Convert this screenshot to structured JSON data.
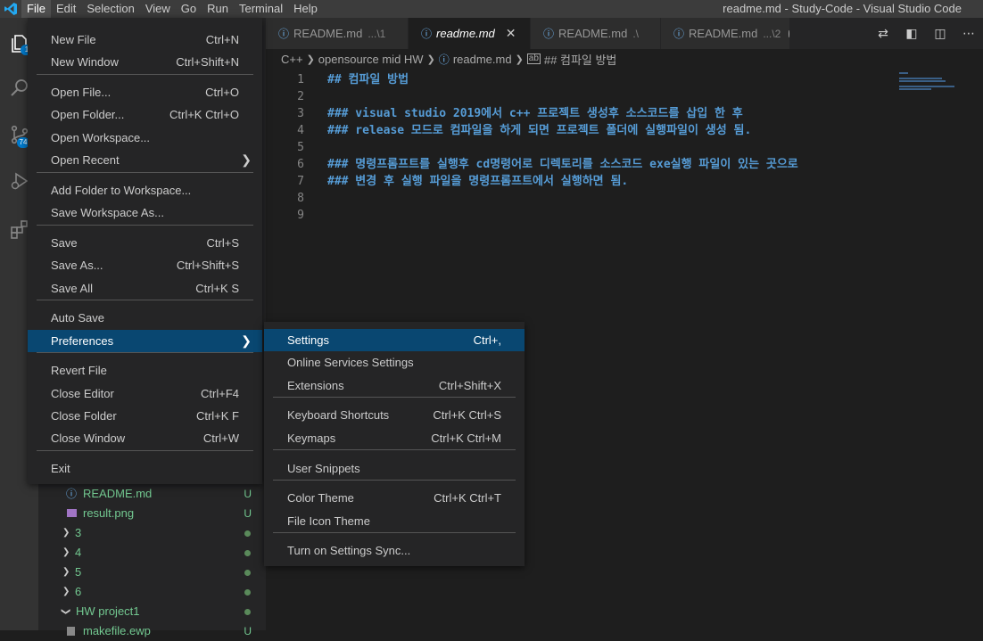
{
  "menubar": {
    "items": [
      "File",
      "Edit",
      "Selection",
      "View",
      "Go",
      "Run",
      "Terminal",
      "Help"
    ],
    "active": 0
  },
  "window_title": "readme.md - Study-Code - Visual Studio Code",
  "activity_badges": {
    "explorer": "1",
    "scm": "74"
  },
  "tabs": [
    {
      "name": "README.md",
      "desc": "...\\1",
      "active": false
    },
    {
      "name": "readme.md",
      "desc": "",
      "active": true
    },
    {
      "name": "README.md",
      "desc": ".\\",
      "active": false
    },
    {
      "name": "README.md",
      "desc": "...\\2",
      "active": false
    }
  ],
  "breadcrumb": [
    "C++",
    "opensource mid HW",
    "readme.md",
    "## 컴파일 방법"
  ],
  "editor": {
    "lines": [
      {
        "n": "1",
        "text": "## 컴파일 방법"
      },
      {
        "n": "2",
        "text": ""
      },
      {
        "n": "3",
        "text": "### visual studio 2019에서 c++ 프로젝트 생성후 소스코드를 삽입 한 후"
      },
      {
        "n": "4",
        "text": "### release 모드로 컴파일을 하게 되면 프로젝트 폴더에 실행파일이 생성 됨."
      },
      {
        "n": "5",
        "text": ""
      },
      {
        "n": "6",
        "text": "### 명령프롬프트를 실행후 cd명령어로 디렉토리를 소스코드 exe실행 파일이 있는 곳으로"
      },
      {
        "n": "7",
        "text": "### 변경 후 실행 파일을 명령프롬프트에서 실행하면 됨."
      },
      {
        "n": "8",
        "text": ""
      },
      {
        "n": "9",
        "text": ""
      }
    ]
  },
  "sidebar": {
    "items": [
      {
        "label": "README.md",
        "status": "U",
        "kind": "file-info"
      },
      {
        "label": "result.png",
        "status": "U",
        "kind": "file-image"
      },
      {
        "label": "3",
        "status": "",
        "kind": "folder"
      },
      {
        "label": "4",
        "status": "",
        "kind": "folder"
      },
      {
        "label": "5",
        "status": "",
        "kind": "folder"
      },
      {
        "label": "6",
        "status": "",
        "kind": "folder"
      },
      {
        "label": "HW project1",
        "status": "",
        "kind": "folder-open"
      },
      {
        "label": "makefile.ewp",
        "status": "U",
        "kind": "file"
      }
    ]
  },
  "file_menu": {
    "groups": [
      [
        {
          "label": "New File",
          "key": "Ctrl+N"
        },
        {
          "label": "New Window",
          "key": "Ctrl+Shift+N"
        }
      ],
      [
        {
          "label": "Open File...",
          "key": "Ctrl+O"
        },
        {
          "label": "Open Folder...",
          "key": "Ctrl+K Ctrl+O"
        },
        {
          "label": "Open Workspace...",
          "key": ""
        },
        {
          "label": "Open Recent",
          "key": "",
          "submenu": true
        }
      ],
      [
        {
          "label": "Add Folder to Workspace...",
          "key": ""
        },
        {
          "label": "Save Workspace As...",
          "key": ""
        }
      ],
      [
        {
          "label": "Save",
          "key": "Ctrl+S"
        },
        {
          "label": "Save As...",
          "key": "Ctrl+Shift+S"
        },
        {
          "label": "Save All",
          "key": "Ctrl+K S"
        }
      ],
      [
        {
          "label": "Auto Save",
          "key": ""
        },
        {
          "label": "Preferences",
          "key": "",
          "submenu": true,
          "selected": true
        }
      ],
      [
        {
          "label": "Revert File",
          "key": ""
        },
        {
          "label": "Close Editor",
          "key": "Ctrl+F4"
        },
        {
          "label": "Close Folder",
          "key": "Ctrl+K F"
        },
        {
          "label": "Close Window",
          "key": "Ctrl+W"
        }
      ],
      [
        {
          "label": "Exit",
          "key": ""
        }
      ]
    ]
  },
  "preferences_menu": {
    "groups": [
      [
        {
          "label": "Settings",
          "key": "Ctrl+,",
          "selected": true
        },
        {
          "label": "Online Services Settings",
          "key": ""
        },
        {
          "label": "Extensions",
          "key": "Ctrl+Shift+X"
        }
      ],
      [
        {
          "label": "Keyboard Shortcuts",
          "key": "Ctrl+K Ctrl+S"
        },
        {
          "label": "Keymaps",
          "key": "Ctrl+K Ctrl+M"
        }
      ],
      [
        {
          "label": "User Snippets",
          "key": ""
        }
      ],
      [
        {
          "label": "Color Theme",
          "key": "Ctrl+K Ctrl+T"
        },
        {
          "label": "File Icon Theme",
          "key": ""
        }
      ],
      [
        {
          "label": "Turn on Settings Sync...",
          "key": ""
        }
      ]
    ]
  }
}
